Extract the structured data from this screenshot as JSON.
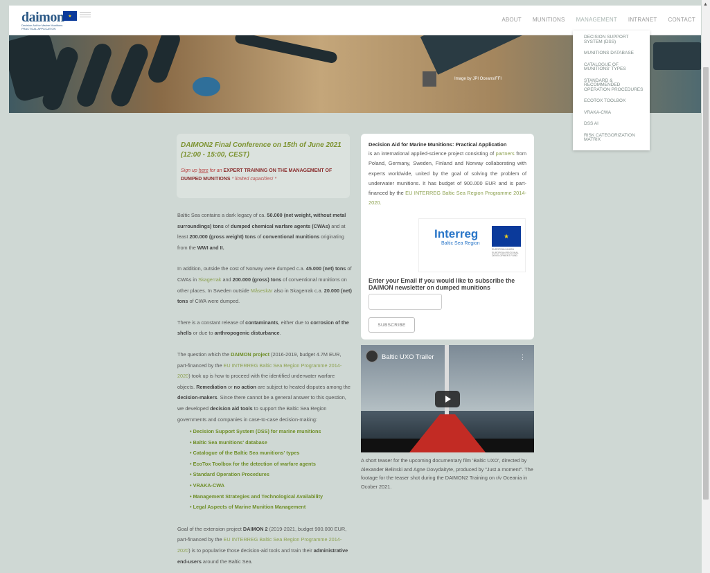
{
  "header": {
    "logo_text": "daimon",
    "logo_sub": "Decision Aid for Marine Munitions PRACTICAL APPLICATION",
    "nav": [
      "ABOUT",
      "MUNITIONS",
      "MANAGEMENT",
      "INTRANET",
      "CONTACT"
    ]
  },
  "dropdown": {
    "items": [
      "DECISION SUPPORT SYSTEM (DSS)",
      "MUNITIONS DATABASE",
      "CATALOGUE OF MUNITIONS' TYPES",
      "STANDARD & RECOMMENDED OPERATION PROCEDURES",
      "ECOTOX TOOLBOX",
      "VRAKA-CWA",
      "DSS AI",
      "RISK CATEGORIZATION MATRIX"
    ]
  },
  "banner": {
    "caption": "Image by JPI Oceans/FFI"
  },
  "announcement": {
    "title": "DAIMON2 Final Conference on 15th of June 2021 (12:00 - 15:00, CEST)",
    "sign_up": "Sign up",
    "here": "here",
    "for_an": "for an",
    "training": "EXPERT TRAINING ON THE MANAGEMENT OF DUMPED MUNITIONS",
    "limited": "* limited capacities! *"
  },
  "left": {
    "p1": {
      "a": "Baltic Sea contains a dark legacy of ca.",
      "b": "50.000 (net weight, without metal surroundings) tons",
      "c": "of",
      "d": "dumped chemical warfare agents (CWAs)",
      "e": "and at least",
      "f": "200.000 (gross weight) tons",
      "g": "of",
      "h": "conventional munitions",
      "i": "originating from the",
      "j": "WWI and II."
    },
    "p2": {
      "a": "In addition, outside the cost of Norway were dumped c.a.",
      "b": "45.000 (net) tons",
      "c": "of CWAs in",
      "d": "Skagerrak",
      "e": "and",
      "f": "200.000 (gross) tons",
      "g": "of conventional munitions on other places. In Sweden outside",
      "h": "Måseskär",
      "i": "also in Skagerrak c.a.",
      "j": "20.000 (net) tons",
      "k": "of CWA were dumped."
    },
    "p3": {
      "a": "There is a constant release of",
      "b": "contaminants",
      "c": ", either due to",
      "d": "corrosion of the shells",
      "e": "or due to",
      "f": "anthropogenic disturbance",
      "g": "."
    },
    "p4": {
      "a": "The question which the",
      "b": "DAIMON project",
      "c": "(2016-2019, budget 4.7M EUR, part-financed by the",
      "d": "EU INTERREG Baltic Sea Region Programme 2014-2020",
      "e": ") took up is how to proceed with the identified underwater warfare objects.",
      "f": "Remediation",
      "g": "or",
      "h": "no action",
      "i": "are subject to heated disputes among the",
      "j": "decision-makers",
      "k": ". Since there cannot be a general answer to this question, we developed",
      "l": "decision aid tools",
      "m": "to support the Baltic Sea Region governments and companies in case-to-case decision-making:"
    },
    "links": [
      "Decision Support System (DSS) for marine munitions",
      "Baltic Sea munitions' database",
      "Catalogue of the Baltic Sea munitions' types",
      "EcoTox Toolbox for the detection of warfare agents",
      "Standard Operation Procedures",
      "VRAKA-CWA",
      "Management Strategies and Technological Availability",
      "Legal Aspects of Marine Munition Management"
    ],
    "p5": {
      "a": "Goal of the extension project",
      "b": "DAIMON 2",
      "c": "(2019-2021, budget 900.000 EUR, part-financed by the",
      "d": "EU INTERREG Baltic Sea Region Programme 2014-2020",
      "e": ") is to popularise those decision-aid tools and train their",
      "f": "administrative end-users",
      "g": "around the Baltic Sea."
    }
  },
  "card": {
    "title": "Decision Aid for Marine Munitions: Practical Application",
    "desc_a": "is an international applied-science project consisting of",
    "partners": "partners",
    "desc_b": "from Poland, Germany, Sweden, Finland and Norway collaborating with experts worldwide, united by the goal of solving the problem of underwater munitions. It has budget of 900.000 EUR and is part-financed by the",
    "programme": "EU INTERREG Baltic Sea Region Programme 2014-2020.",
    "interreg_word": "Interreg",
    "interreg_sub": "Baltic Sea Region",
    "eu_text": "EUROPEAN UNION EUROPEAN REGIONAL DEVELOPMENT FUND",
    "newsletter_title": "Enter your Email if you would like to subscribe the DAIMON newsletter on dumped munitions",
    "email_value": "",
    "subscribe": "SUBSCRIBE"
  },
  "video": {
    "title": "Baltic UXO Trailer",
    "caption": "A short teaser for the upcoming documentary film 'Baltic UXO', directed by Alexander Belinski and Agne Dovydaityte, produced by \"Just a moment\". The footage for the teaser shot during the DAIMON2 Training on r/v Oceania in Ocober 2021."
  },
  "colors": {
    "accent_green": "#6f8e28",
    "link_green": "#8da150",
    "accent_red": "#8a2e2e",
    "brand_blue": "#2d5a87"
  }
}
